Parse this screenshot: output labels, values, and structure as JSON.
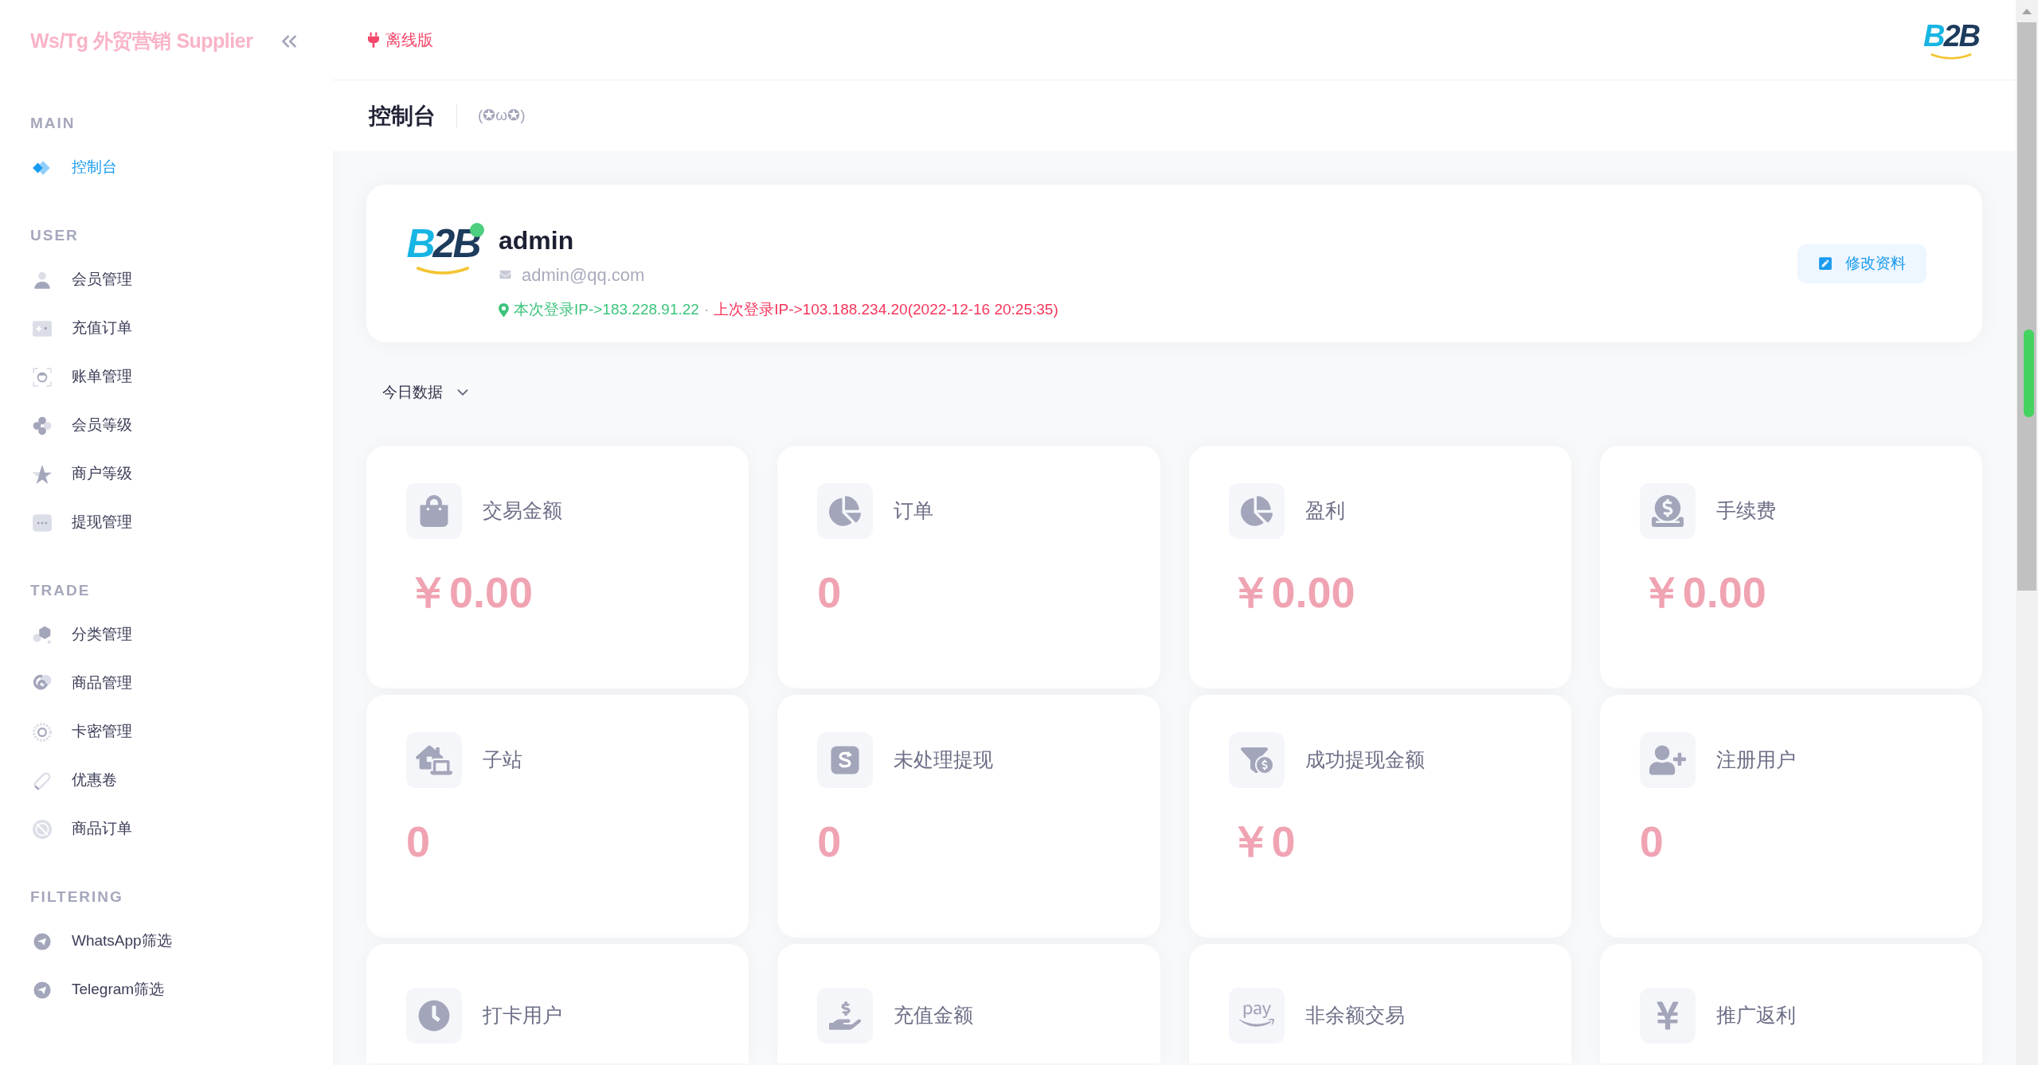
{
  "sidebar": {
    "brand": "Ws/Tg 外贸营销 Supplier",
    "sections": [
      {
        "title": "MAIN",
        "items": [
          {
            "label": "控制台",
            "selected": true
          }
        ]
      },
      {
        "title": "USER",
        "items": [
          {
            "label": "会员管理",
            "selected": false
          },
          {
            "label": "充值订单",
            "selected": false
          },
          {
            "label": "账单管理",
            "selected": false
          },
          {
            "label": "会员等级",
            "selected": false
          },
          {
            "label": "商户等级",
            "selected": false
          },
          {
            "label": "提现管理",
            "selected": false
          }
        ]
      },
      {
        "title": "TRADE",
        "items": [
          {
            "label": "分类管理",
            "selected": false
          },
          {
            "label": "商品管理",
            "selected": false
          },
          {
            "label": "卡密管理",
            "selected": false
          },
          {
            "label": "优惠卷",
            "selected": false
          },
          {
            "label": "商品订单",
            "selected": false
          }
        ]
      },
      {
        "title": "FILTERING",
        "items": [
          {
            "label": "WhatsApp筛选",
            "selected": false
          },
          {
            "label": "Telegram筛选",
            "selected": false
          }
        ]
      }
    ]
  },
  "top_bar": {
    "mode_label": "离线版",
    "logo": "B2B"
  },
  "page_header": {
    "title": "控制台",
    "subtitle": "(✪ω✪)"
  },
  "profile": {
    "logo": "B2B",
    "online": true,
    "name": "admin",
    "email": "admin@qq.com",
    "current_login": "本次登录IP->183.228.91.22",
    "separator": "·",
    "last_login": "上次登录IP->103.188.234.20(2022-12-16 20:25:35)",
    "edit_button": "修改资料"
  },
  "period_selector": {
    "label": "今日数据"
  },
  "stats": [
    {
      "label": "交易金额",
      "value": "￥0.00"
    },
    {
      "label": "订单",
      "value": "0"
    },
    {
      "label": "盈利",
      "value": "￥0.00"
    },
    {
      "label": "手续费",
      "value": "￥0.00"
    },
    {
      "label": "子站",
      "value": "0"
    },
    {
      "label": "未处理提现",
      "value": "0"
    },
    {
      "label": "成功提现金额",
      "value": "￥0"
    },
    {
      "label": "注册用户",
      "value": "0"
    },
    {
      "label": "打卡用户"
    },
    {
      "label": "充值金额"
    },
    {
      "label": "非余额交易"
    },
    {
      "label": "推广返利"
    }
  ]
}
